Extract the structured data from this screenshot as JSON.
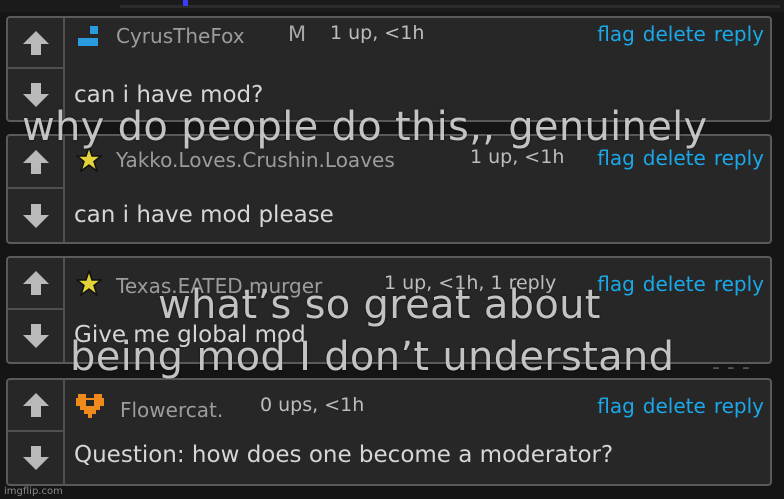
{
  "comments": [
    {
      "username": "CyrusTheFox",
      "mod_badge": "M",
      "meta": "1 up, <1h",
      "body": "can i have mod?",
      "avatar_icon": "blue-pixel-icon",
      "accent": "#1aa8e8"
    },
    {
      "username": "Yakko.Loves.Crushin.Loaves",
      "meta": "1 up, <1h",
      "body": "can i have mod please",
      "avatar_icon": "star-icon",
      "accent": "#1aa8e8"
    },
    {
      "username": "Texas.EATED.murger",
      "meta": "1 up, <1h, 1 reply",
      "body": "Give me global mod",
      "avatar_icon": "star-icon",
      "accent": "#1aa8e8"
    },
    {
      "username": "Flowercat.",
      "meta": "0 ups, <1h",
      "body": "Question: how does one become a moderator?",
      "avatar_icon": "orange-pixel-heart-icon",
      "accent": "#1aa8e8"
    }
  ],
  "actions": {
    "flag": "flag",
    "delete": "delete",
    "reply": "reply"
  },
  "overlays": {
    "caption1": "why do people do this,, genuinely",
    "caption2_line1": "what’s so great about",
    "caption2_line2": "being mod I don’t understand"
  },
  "watermark": "imgflip.com"
}
